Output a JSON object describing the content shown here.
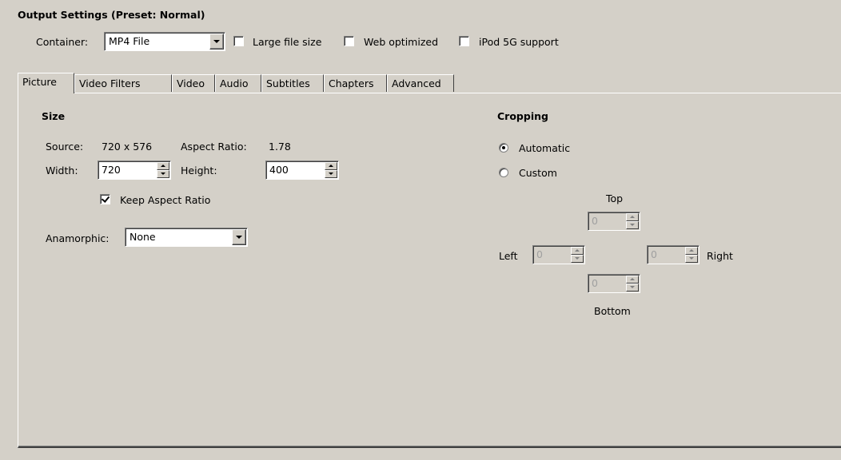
{
  "output_settings": {
    "title": "Output Settings (Preset: Normal)",
    "container_label": "Container:",
    "container_value": "MP4 File",
    "large_file_label": "Large file size",
    "large_file_checked": false,
    "web_optimized_label": "Web optimized",
    "web_optimized_checked": false,
    "ipod_label": "iPod 5G support",
    "ipod_checked": false
  },
  "tabs": [
    {
      "label": "Picture",
      "active": true
    },
    {
      "label": "Video Filters",
      "active": false
    },
    {
      "label": "Video",
      "active": false
    },
    {
      "label": "Audio",
      "active": false
    },
    {
      "label": "Subtitles",
      "active": false
    },
    {
      "label": "Chapters",
      "active": false
    },
    {
      "label": "Advanced",
      "active": false
    }
  ],
  "size": {
    "title": "Size",
    "source_label": "Source:",
    "source_value": "720 x 576",
    "aspect_label": "Aspect Ratio:",
    "aspect_value": "1.78",
    "width_label": "Width:",
    "width_value": "720",
    "height_label": "Height:",
    "height_value": "400",
    "keep_aspect_label": "Keep Aspect Ratio",
    "keep_aspect_checked": true,
    "anamorphic_label": "Anamorphic:",
    "anamorphic_value": "None"
  },
  "cropping": {
    "title": "Cropping",
    "automatic_label": "Automatic",
    "custom_label": "Custom",
    "selected": "Automatic",
    "top_label": "Top",
    "top_value": "0",
    "left_label": "Left",
    "left_value": "0",
    "right_label": "Right",
    "right_value": "0",
    "bottom_label": "Bottom",
    "bottom_value": "0"
  }
}
